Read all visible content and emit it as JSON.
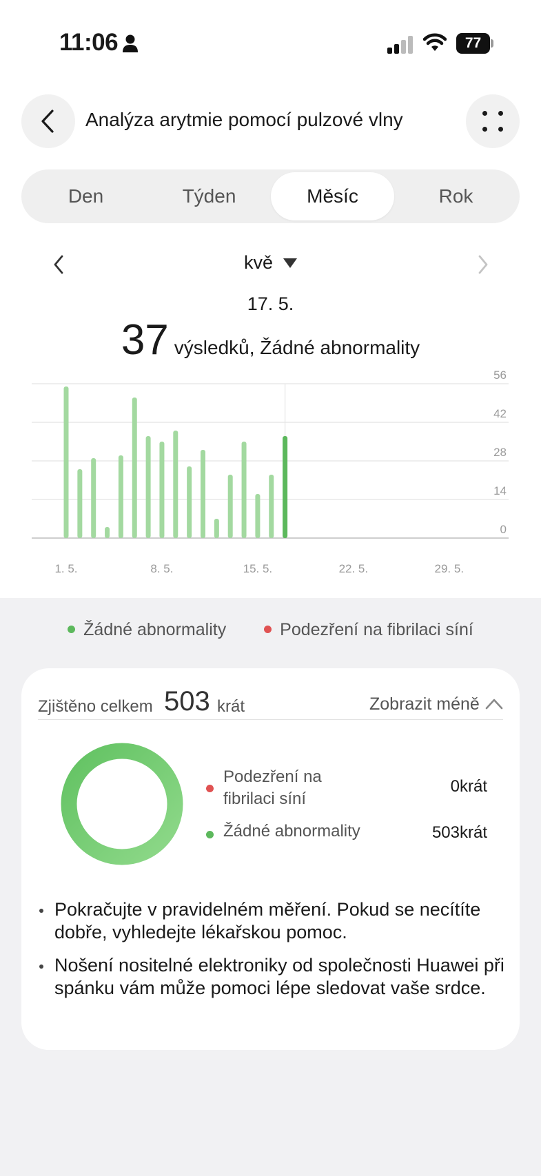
{
  "status_bar": {
    "time": "11:06",
    "battery": "77"
  },
  "header": {
    "title": "Analýza arytmie pomocí pulzové vlny"
  },
  "tabs": [
    {
      "label": "Den",
      "active": false
    },
    {
      "label": "Týden",
      "active": false
    },
    {
      "label": "Měsíc",
      "active": true
    },
    {
      "label": "Rok",
      "active": false
    }
  ],
  "period": {
    "month": "kvě",
    "selected_date": "17. 5.",
    "count": "37",
    "count_text": "výsledků, Žádné abnormality"
  },
  "chart_data": {
    "type": "bar",
    "x": [
      1,
      2,
      3,
      4,
      5,
      6,
      7,
      8,
      9,
      10,
      11,
      12,
      13,
      14,
      15,
      16,
      17
    ],
    "values": [
      55,
      25,
      29,
      4,
      30,
      51,
      37,
      35,
      39,
      26,
      32,
      7,
      23,
      35,
      16,
      23,
      37
    ],
    "selected_index": 16,
    "ylim": [
      0,
      56
    ],
    "y_ticks": [
      "0",
      "14",
      "28",
      "42",
      "56"
    ],
    "x_tick_labels": [
      "1. 5.",
      "8. 5.",
      "15. 5.",
      "22. 5.",
      "29. 5."
    ],
    "x_tick_days": [
      1,
      8,
      15,
      22,
      29
    ],
    "days_in_month": 31,
    "bar_color": "#a3d9a0",
    "selected_color": "#5cb85c",
    "grid": true
  },
  "legend": [
    {
      "label": "Žádné abnormality",
      "color": "#5cb85c"
    },
    {
      "label": "Podezření na fibrilaci síní",
      "color": "#e05252"
    }
  ],
  "summary_card": {
    "total_label": "Zjištěno celkem",
    "total_value": "503",
    "total_unit": "krát",
    "toggle_label": "Zobrazit méně",
    "breakdown": [
      {
        "label": "Podezření na fibrilaci síní",
        "value": "0krát",
        "color": "#e05252"
      },
      {
        "label": "Žádné abnormality",
        "value": "503krát",
        "color": "#5cb85c"
      }
    ],
    "tips": [
      "Pokračujte v pravidelném měření. Pokud se necítíte dobře, vyhledejte lékařskou pomoc.",
      "Nošení nositelné elektroniky od společnosti Huawei při spánku vám může pomoci lépe sledovat vaše srdce."
    ]
  }
}
